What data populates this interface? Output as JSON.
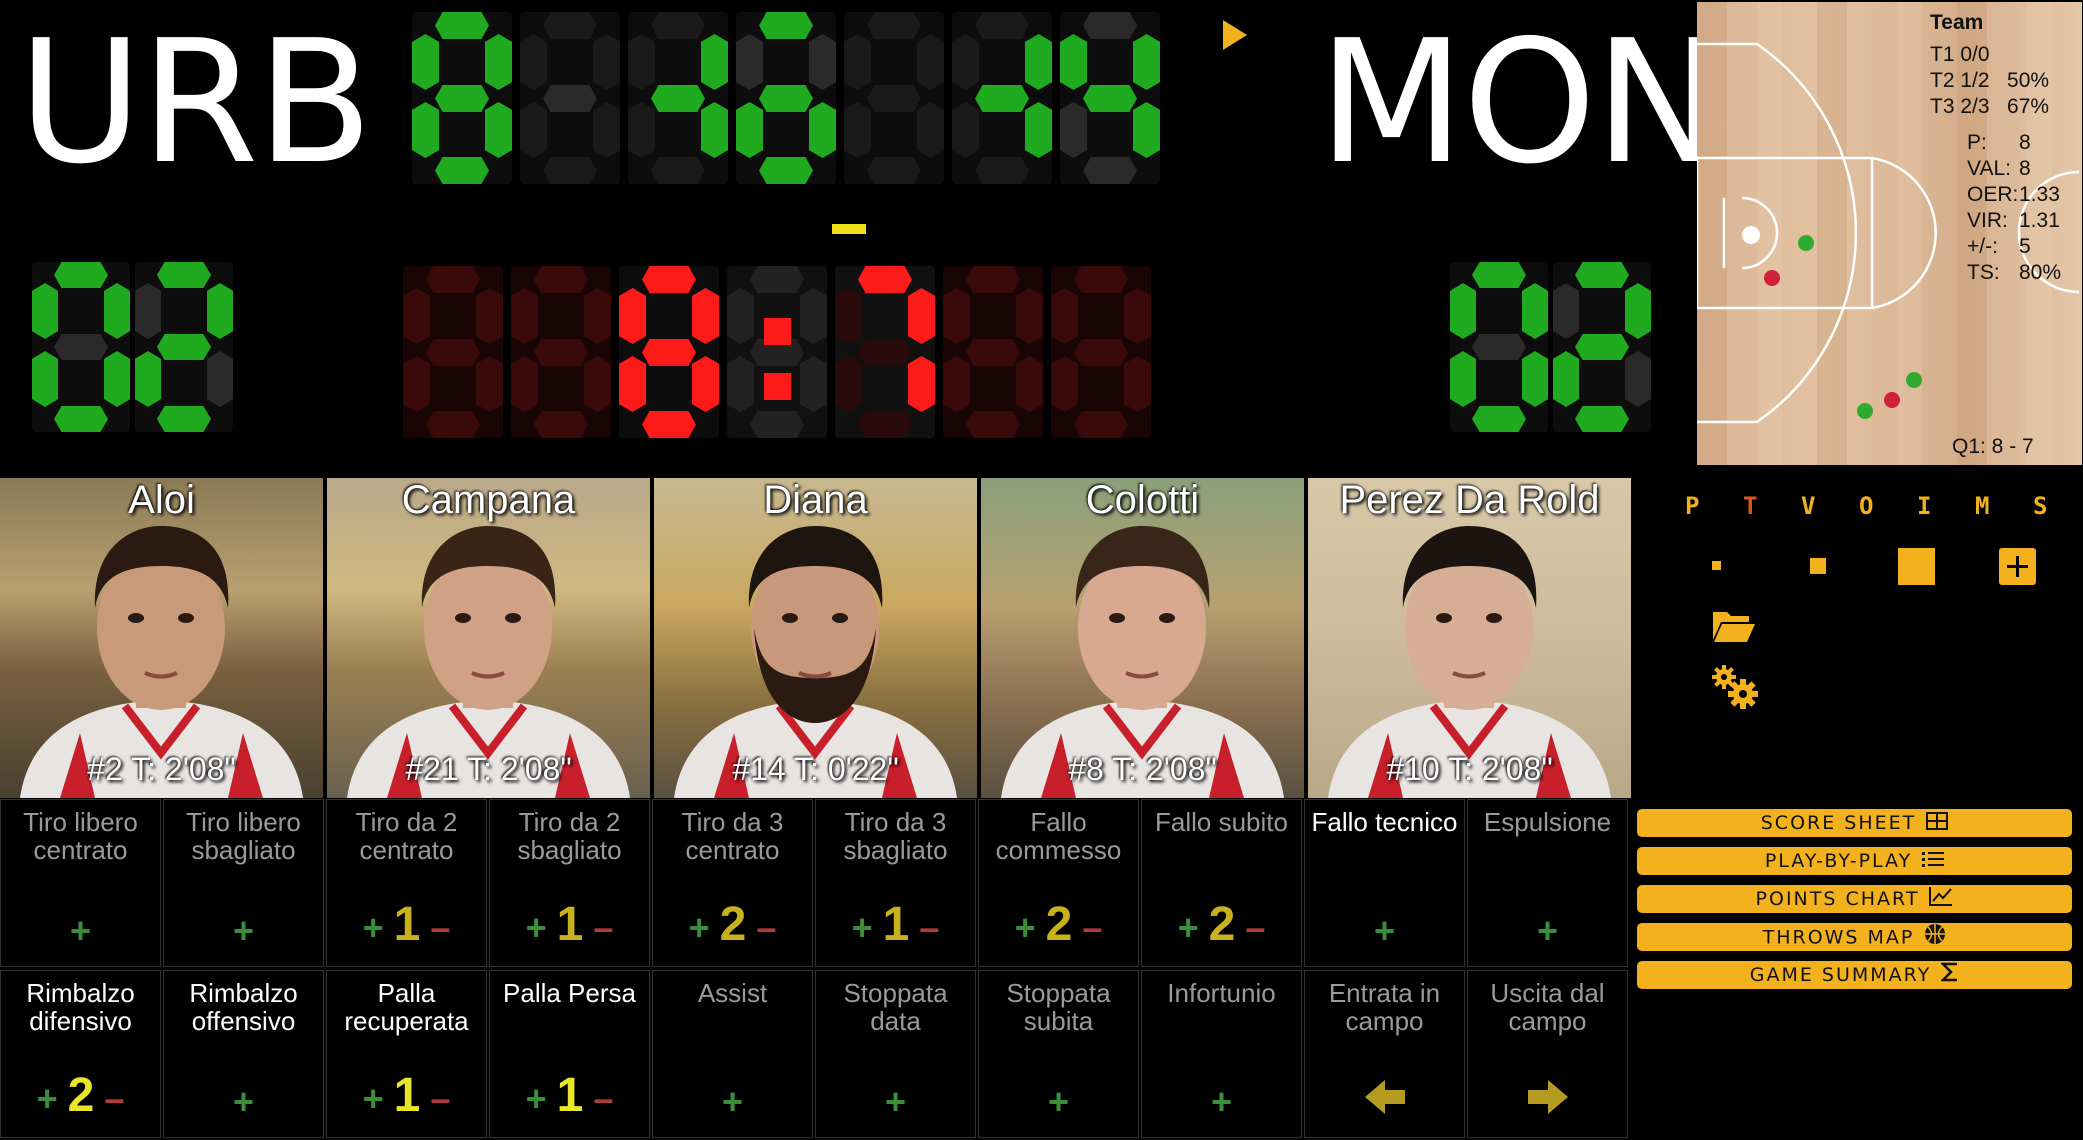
{
  "scoreboard": {
    "home_team": "URB",
    "away_team": "MON",
    "home_fouls": "02",
    "away_fouls": "02",
    "game_clock": "8:7",
    "possession_arrow_icon": "triangle-right-icon",
    "shot_clock_marker": "-"
  },
  "court_panel": {
    "title": "Team",
    "stats": [
      "T1 0/0",
      "T2 1/2   50%",
      "T3 2/3   67%"
    ],
    "metrics": [
      {
        "label": "P:",
        "value": "8"
      },
      {
        "label": "VAL:",
        "value": "8"
      },
      {
        "label": "OER:",
        "value": "1.33"
      },
      {
        "label": "VIR:",
        "value": "1.31"
      },
      {
        "label": "+/-:",
        "value": "5"
      },
      {
        "label": "TS:",
        "value": "80%"
      }
    ],
    "quarter_score": "Q1: 8 - 7"
  },
  "players": [
    {
      "name": "Aloi",
      "info": "#2 T: 2'08\""
    },
    {
      "name": "Campana",
      "info": "#21 T: 2'08\""
    },
    {
      "name": "Diana",
      "info": "#14 T: 0'22\""
    },
    {
      "name": "Colotti",
      "info": "#8 T: 2'08\""
    },
    {
      "name": "Perez Da Rold",
      "info": "#10 T: 2'08\""
    }
  ],
  "stats_row1": [
    {
      "label": "Tiro libero centrato",
      "value": ""
    },
    {
      "label": "Tiro libero sbagliato",
      "value": ""
    },
    {
      "label": "Tiro da 2 centrato",
      "value": "1"
    },
    {
      "label": "Tiro da 2 sbagliato",
      "value": "1"
    },
    {
      "label": "Tiro da 3 centrato",
      "value": "2"
    },
    {
      "label": "Tiro da 3 sbagliato",
      "value": "1"
    },
    {
      "label": "Fallo commesso",
      "value": "2"
    },
    {
      "label": "Fallo subito",
      "value": "2"
    },
    {
      "label": "Fallo tecnico",
      "value": ""
    },
    {
      "label": "Espulsione",
      "value": ""
    }
  ],
  "stats_row2": [
    {
      "label": "Rimbalzo difensivo",
      "value": "2"
    },
    {
      "label": "Rimbalzo offensivo",
      "value": ""
    },
    {
      "label": "Palla recuperata",
      "value": "1"
    },
    {
      "label": "Palla Persa",
      "value": "1"
    },
    {
      "label": "Assist",
      "value": ""
    },
    {
      "label": "Stoppata data",
      "value": ""
    },
    {
      "label": "Stoppata subita",
      "value": ""
    },
    {
      "label": "Infortunio",
      "value": ""
    },
    {
      "label": "Entrata in campo",
      "value": ""
    },
    {
      "label": "Uscita dal campo",
      "value": ""
    }
  ],
  "controls": {
    "plus": "+",
    "minus": "–"
  },
  "side_letters": [
    "P",
    "T",
    "V",
    "O",
    "I",
    "M",
    "S"
  ],
  "menu": [
    {
      "label": "SCORE SHEET",
      "icon": "table-icon"
    },
    {
      "label": "PLAY-BY-PLAY",
      "icon": "list-icon"
    },
    {
      "label": "POINTS CHART",
      "icon": "line-chart-icon"
    },
    {
      "label": "THROWS MAP",
      "icon": "basketball-icon"
    },
    {
      "label": "GAME SUMMARY",
      "icon": "sigma-icon"
    }
  ],
  "colors": {
    "segment_on_green": "#1faa1f",
    "segment_off": "#2b2b2b",
    "segment_on_red": "#ff1a1a",
    "segment_off_red": "#3a0a0a",
    "accent": "#f2b11d"
  }
}
